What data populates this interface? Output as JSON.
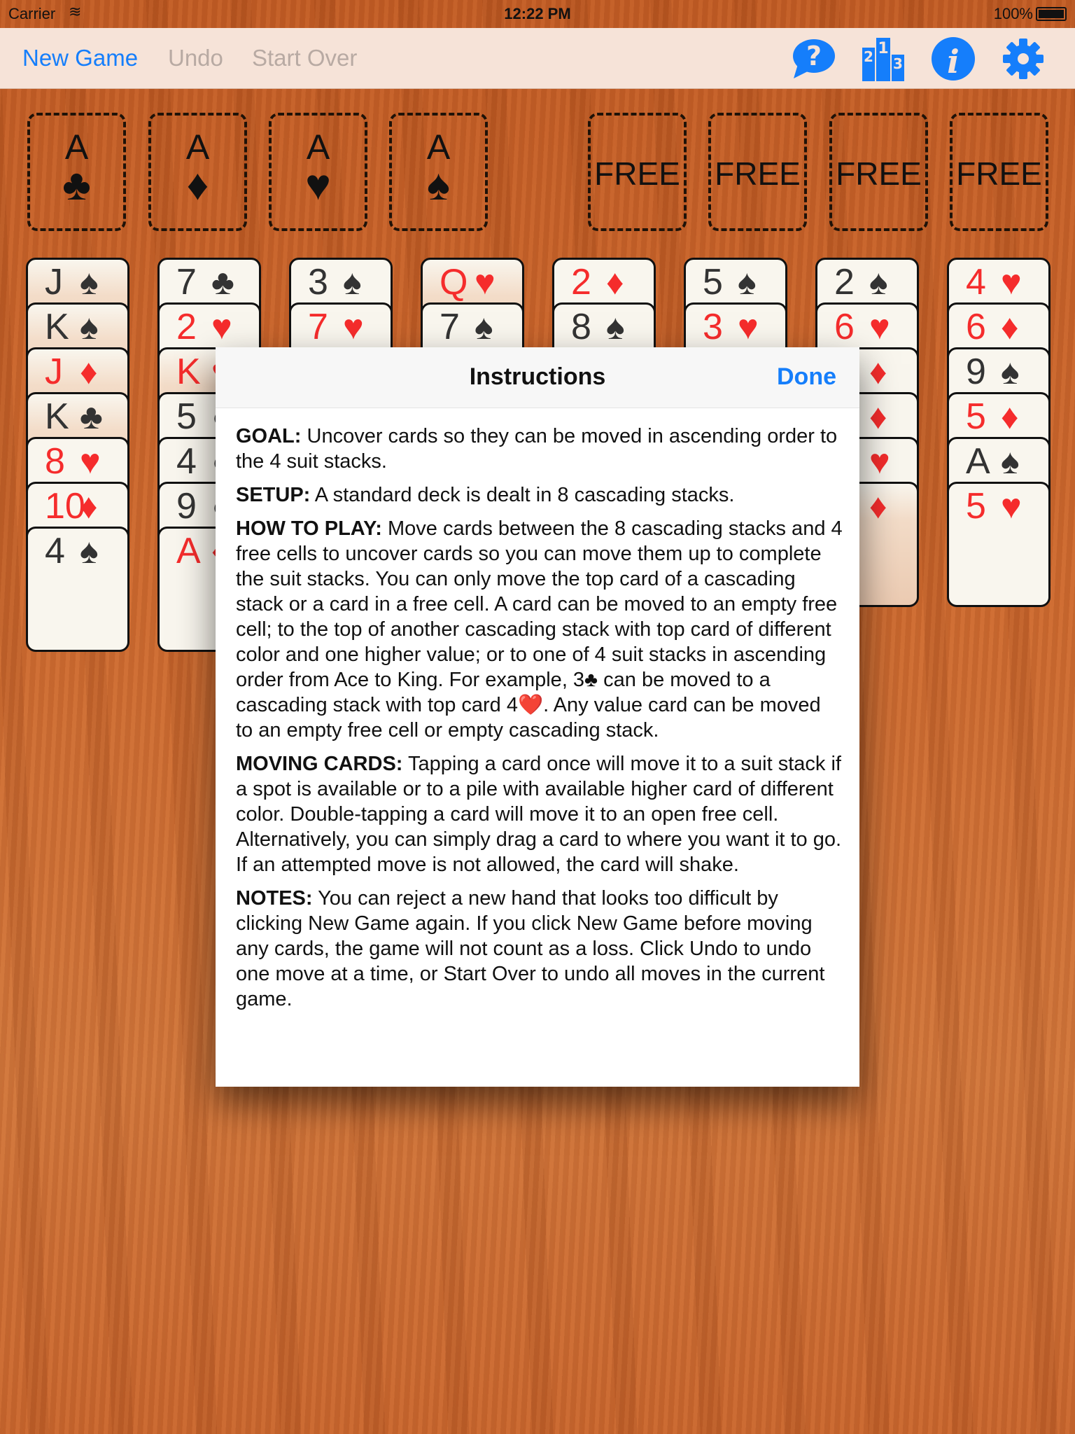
{
  "status_bar": {
    "carrier": "Carrier",
    "time": "12:22 PM",
    "battery": "100%"
  },
  "toolbar": {
    "new_game": "New Game",
    "undo": "Undo",
    "start_over": "Start Over",
    "icons": [
      "help-bubble-icon",
      "leaderboard-podium-icon",
      "info-icon",
      "gear-icon"
    ],
    "accent_color": "#157efb"
  },
  "foundations": [
    {
      "rank": "A",
      "suit": "♣"
    },
    {
      "rank": "A",
      "suit": "♦"
    },
    {
      "rank": "A",
      "suit": "♥"
    },
    {
      "rank": "A",
      "suit": "♠"
    }
  ],
  "free_cells": [
    "FREE",
    "FREE",
    "FREE",
    "FREE"
  ],
  "columns": [
    [
      {
        "rank": "J",
        "suit": "♠",
        "face": true
      },
      {
        "rank": "K",
        "suit": "♠",
        "face": true
      },
      {
        "rank": "J",
        "suit": "♦",
        "face": true
      },
      {
        "rank": "K",
        "suit": "♣",
        "face": true
      },
      {
        "rank": "8",
        "suit": "♥"
      },
      {
        "rank": "10",
        "suit": "♦"
      },
      {
        "rank": "4",
        "suit": "♠"
      }
    ],
    [
      {
        "rank": "7",
        "suit": "♣"
      },
      {
        "rank": "2",
        "suit": "♥"
      },
      {
        "rank": "K",
        "suit": "♥",
        "face": true
      },
      {
        "rank": "5",
        "suit": "●",
        "color": "black"
      },
      {
        "rank": "4",
        "suit": "●",
        "color": "black"
      },
      {
        "rank": "9",
        "suit": "●",
        "color": "black"
      },
      {
        "rank": "A",
        "suit": "♦"
      }
    ],
    [
      {
        "rank": "3",
        "suit": "♠"
      },
      {
        "rank": "7",
        "suit": "♥"
      }
    ],
    [
      {
        "rank": "Q",
        "suit": "♥",
        "face": true
      },
      {
        "rank": "7",
        "suit": "♠"
      }
    ],
    [
      {
        "rank": "2",
        "suit": "♦"
      },
      {
        "rank": "8",
        "suit": "♠"
      }
    ],
    [
      {
        "rank": "5",
        "suit": "♠"
      },
      {
        "rank": "3",
        "suit": "♥"
      }
    ],
    [
      {
        "rank": "2",
        "suit": "♠"
      },
      {
        "rank": "6",
        "suit": "♥"
      },
      {
        "rank": "",
        "suit": "♦"
      },
      {
        "rank": "",
        "suit": "♦"
      },
      {
        "rank": "",
        "suit": "♥"
      },
      {
        "rank": "",
        "suit": "♦",
        "face": true
      }
    ],
    [
      {
        "rank": "4",
        "suit": "♥"
      },
      {
        "rank": "6",
        "suit": "♦"
      },
      {
        "rank": "9",
        "suit": "♠"
      },
      {
        "rank": "5",
        "suit": "♦"
      },
      {
        "rank": "A",
        "suit": "♠"
      },
      {
        "rank": "5",
        "suit": "♥"
      }
    ]
  ],
  "modal": {
    "title": "Instructions",
    "done": "Done",
    "sections": [
      {
        "label": "GOAL:",
        "text": " Uncover cards so they can be moved in ascending order to the 4 suit stacks."
      },
      {
        "label": "SETUP:",
        "text": " A standard deck is dealt in 8 cascading stacks."
      },
      {
        "label": "HOW TO PLAY:",
        "text": " Move cards between the 8 cascading stacks and 4 free cells to uncover cards so you can move them up to complete the suit stacks. You can only move the top card of a cascading stack or a card in a free cell. A card can be moved to an empty free cell; to the top of another cascading stack with top card of different color and one higher value; or to one of 4 suit stacks in ascending order from Ace to King. For example, 3♣ can be moved to a cascading stack with top card 4❤️. Any value card can be moved to an empty free cell or empty cascading stack."
      },
      {
        "label": "MOVING CARDS:",
        "text": " Tapping a card once will move it to a suit stack if a spot is available or to a pile with available higher card of different color. Double-tapping a card will move it to an open free cell. Alternatively, you can simply drag a card to where you want it to go. If an attempted move is not allowed, the card will shake."
      },
      {
        "label": "NOTES:",
        "text": " You can reject a new hand that looks too difficult by clicking New Game again. If you click New Game before moving any cards, the game will not count as a loss. Click Undo to undo one move at a time, or Start Over to undo all moves in the current game."
      }
    ]
  }
}
